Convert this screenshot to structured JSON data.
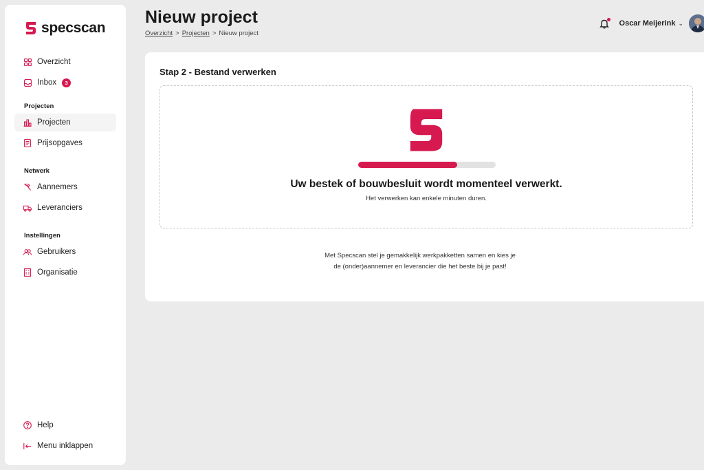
{
  "app": {
    "name": "specscan",
    "brand_color": "#d6194f"
  },
  "sidebar": {
    "top_items": [
      {
        "label": "Overzicht",
        "icon": "grid-icon"
      },
      {
        "label": "Inbox",
        "icon": "inbox-icon",
        "badge": "3"
      }
    ],
    "sections": [
      {
        "label": "Projecten",
        "items": [
          {
            "label": "Projecten",
            "icon": "chart-icon",
            "active": true
          },
          {
            "label": "Prijsopgaves",
            "icon": "document-icon"
          }
        ]
      },
      {
        "label": "Netwerk",
        "items": [
          {
            "label": "Aannemers",
            "icon": "hammer-icon"
          },
          {
            "label": "Leveranciers",
            "icon": "truck-icon"
          }
        ]
      },
      {
        "label": "Instellingen",
        "items": [
          {
            "label": "Gebruikers",
            "icon": "users-icon"
          },
          {
            "label": "Organisatie",
            "icon": "building-icon"
          }
        ]
      }
    ],
    "bottom_items": [
      {
        "label": "Help",
        "icon": "help-icon"
      },
      {
        "label": "Menu inklappen",
        "icon": "collapse-icon"
      }
    ]
  },
  "header": {
    "title": "Nieuw project",
    "breadcrumb": [
      "Overzicht",
      "Projecten",
      "Nieuw project"
    ],
    "separator": ">",
    "user_name": "Oscar Meijerink"
  },
  "main": {
    "step_title": "Stap 2 - Bestand verwerken",
    "progress": 0.72,
    "message": "Uw bestek of bouwbesluit wordt momenteel verwerkt.",
    "submessage": "Het verwerken kan enkele minuten duren.",
    "footer_line1": "Met Specscan stel je gemakkelijk werkpakketten samen en kies je",
    "footer_line2": "de (onder)aannemer en leverancier die het beste bij je past!"
  }
}
